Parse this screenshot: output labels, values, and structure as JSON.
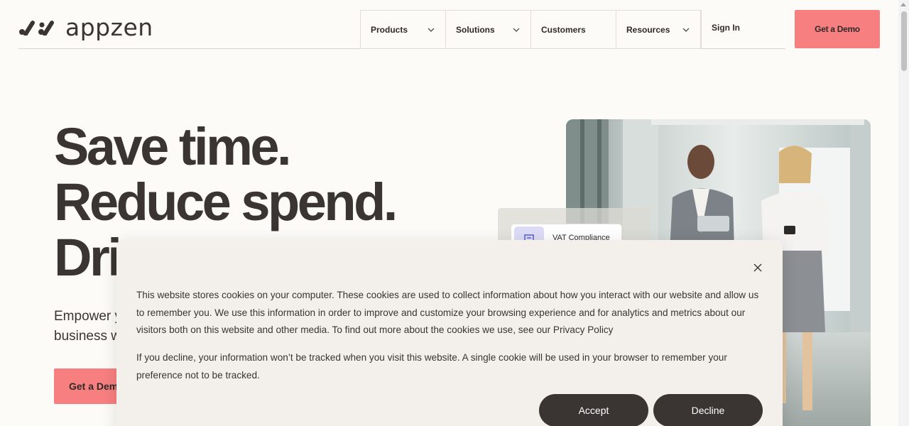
{
  "brand": {
    "name": "appzen",
    "accent": "#f77f7f",
    "text": "#3a3432"
  },
  "nav": {
    "items": [
      {
        "label": "Products",
        "has_dropdown": true
      },
      {
        "label": "Solutions",
        "has_dropdown": true
      },
      {
        "label": "Customers",
        "has_dropdown": false
      },
      {
        "label": "Resources",
        "has_dropdown": true
      }
    ],
    "sign_in": "Sign In",
    "demo_button": "Get a Demo"
  },
  "hero": {
    "line1": "Save time.",
    "line2": "Reduce spend.",
    "line3": "Dri",
    "subtitle_line1": "Empower y",
    "subtitle_line2": "business w",
    "cta": "Get a Demo",
    "card_label": "VAT Compliance"
  },
  "cookie": {
    "paragraph1": "This website stores cookies on your computer. These cookies are used to collect information about how you interact with our website and allow us to remember you. We use this information in order to improve and customize your browsing experience and for analytics and metrics about our visitors both on this website and other media. To find out more about the cookies we use, see our Privacy Policy",
    "paragraph2": "If you decline, your information won’t be tracked when you visit this website. A single cookie will be used in your browser to remember your preference not to be tracked.",
    "accept": "Accept",
    "decline": "Decline"
  }
}
